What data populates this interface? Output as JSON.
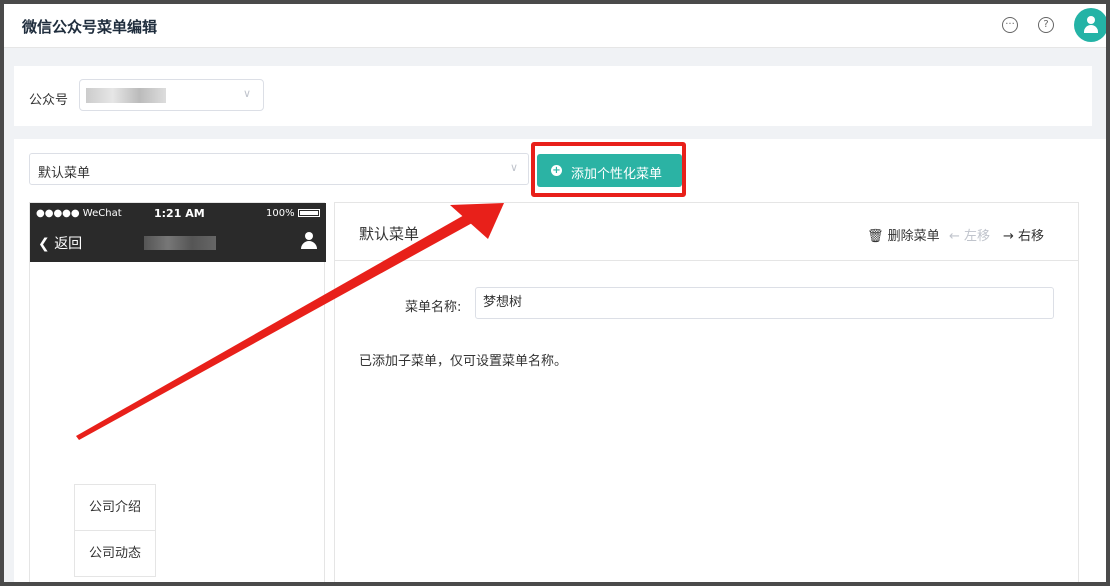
{
  "app": {
    "title": "微信公众号菜单编辑"
  },
  "account": {
    "label": "公众号"
  },
  "menu_select": {
    "value": "默认菜单"
  },
  "add_button": {
    "label": "添加个性化菜单",
    "color": "#2bb3a4"
  },
  "highlight_color": "#e8201a",
  "phone": {
    "carrier": "●●●●● WeChat",
    "time": "1:21 AM",
    "battery": "100%",
    "back_label": "返回",
    "submenus": [
      "公司介绍",
      "公司动态"
    ]
  },
  "editor": {
    "title": "默认菜单",
    "delete_label": "删除菜单",
    "move_left_label": "左移",
    "move_right_label": "右移",
    "name_label": "菜单名称:",
    "name_value": "梦想树",
    "hint": "已添加子菜单，仅可设置菜单名称。"
  }
}
